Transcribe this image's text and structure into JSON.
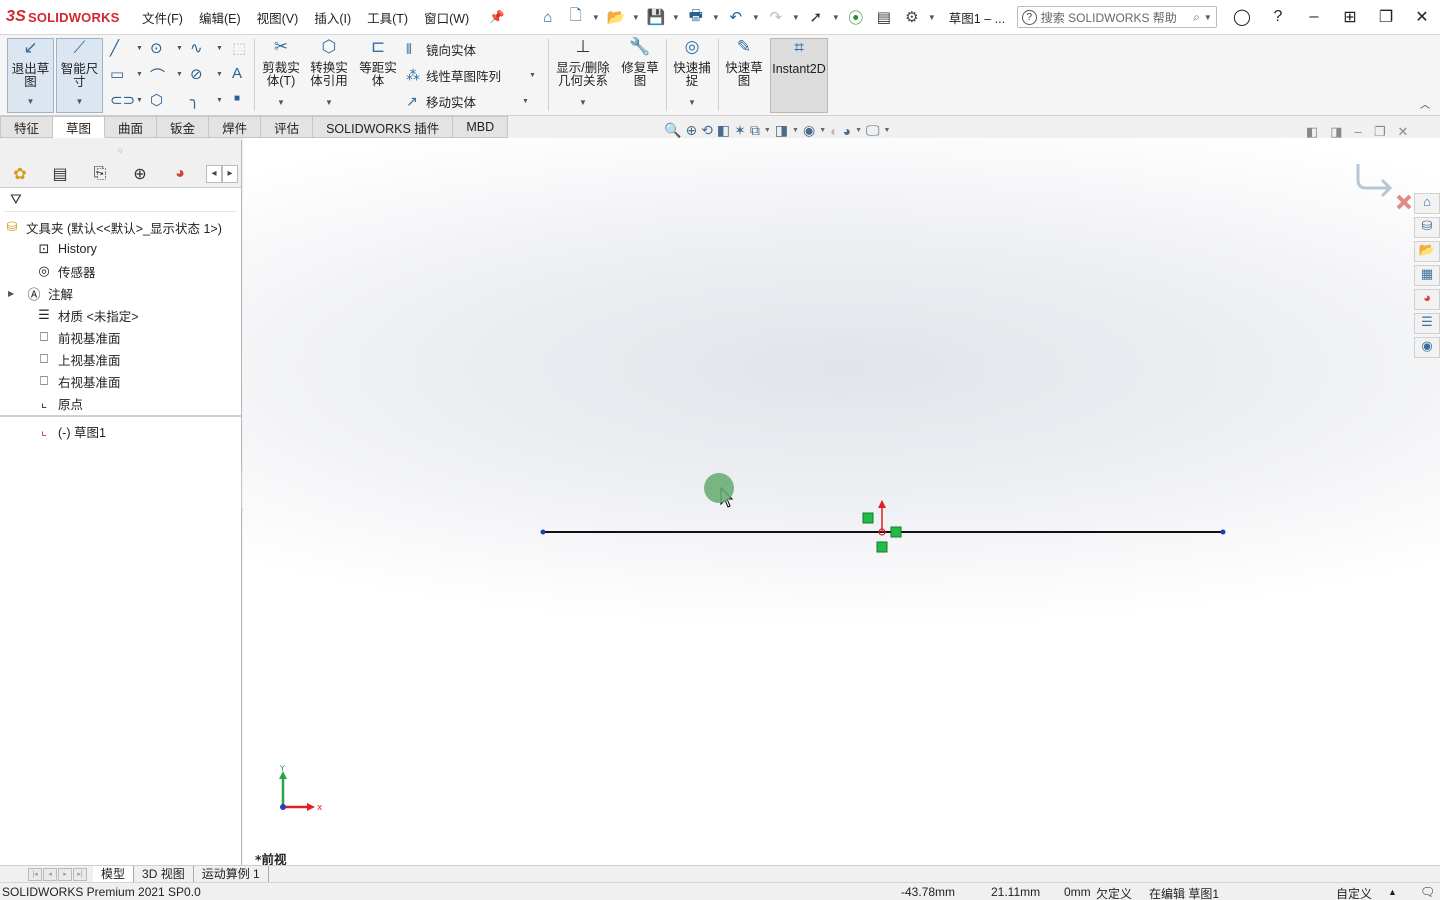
{
  "app": {
    "brand": "SOLIDWORKS",
    "document_title": "草图1 – ...",
    "menu": [
      "文件(F)",
      "编辑(E)",
      "视图(V)",
      "插入(I)",
      "工具(T)",
      "窗口(W)"
    ],
    "help_search_placeholder": "搜索 SOLIDWORKS 帮助"
  },
  "ribbon": {
    "exit_sketch": "退出草图",
    "smart_dimension": "智能尺寸",
    "trim": "剪裁实体(T)",
    "convert": "转换实体引用",
    "offset": "等距实体",
    "mirror": "镜向实体",
    "linear_pattern": "线性草图阵列",
    "move": "移动实体",
    "display_relations": "显示/删除几何关系",
    "repair": "修复草图",
    "quick_snaps": "快速捕捉",
    "rapid_sketch": "快速草图",
    "instant2d": "Instant2D"
  },
  "tabs": [
    {
      "label": "特征",
      "active": false
    },
    {
      "label": "草图",
      "active": true
    },
    {
      "label": "曲面",
      "active": false
    },
    {
      "label": "钣金",
      "active": false
    },
    {
      "label": "焊件",
      "active": false
    },
    {
      "label": "评估",
      "active": false
    },
    {
      "label": "SOLIDWORKS 插件",
      "active": false
    },
    {
      "label": "MBD",
      "active": false
    }
  ],
  "tree": {
    "root": "文具夹 (默认<<默认>_显示状态 1>)",
    "items": [
      {
        "label": "History",
        "icon": "history-icon"
      },
      {
        "label": "传感器",
        "icon": "sensor-icon"
      },
      {
        "label": "注解",
        "icon": "annotation-icon"
      },
      {
        "label": "材质 <未指定>",
        "icon": "material-icon"
      },
      {
        "label": "前视基准面",
        "icon": "plane-icon"
      },
      {
        "label": "上视基准面",
        "icon": "plane-icon"
      },
      {
        "label": "右视基准面",
        "icon": "plane-icon"
      },
      {
        "label": "原点",
        "icon": "origin-icon"
      }
    ],
    "sketch": "(-) 草图1"
  },
  "viewport": {
    "view_name": "*前视",
    "axis_x": "x",
    "axis_y": "Y"
  },
  "bottom_tabs": [
    "模型",
    "3D 视图",
    "运动算例 1"
  ],
  "status": {
    "product": "SOLIDWORKS Premium 2021 SP0.0",
    "x": "-43.78mm",
    "y": "21.11mm",
    "z": "0mm",
    "definition": "欠定义",
    "editing": "在编辑 草图1",
    "units": "自定义"
  },
  "colors": {
    "brand_red": "#d6262f",
    "sketch_line": "#000000",
    "relation_green": "#22bb44",
    "accent_blue": "#2f6da3"
  }
}
